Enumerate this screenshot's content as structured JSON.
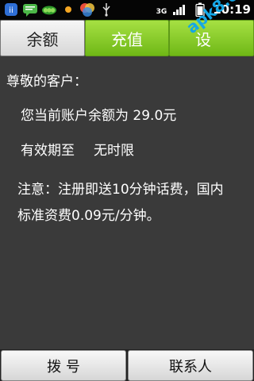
{
  "status_bar": {
    "time": "10:19",
    "network": "3G",
    "icons": [
      "app-icon",
      "message-icon",
      "peas-icon",
      "dot-icon",
      "colorful-icon",
      "usb-icon"
    ]
  },
  "tabs": [
    {
      "label": "余额",
      "active": false
    },
    {
      "label": "充值",
      "active": true
    },
    {
      "label": "设",
      "active": false
    }
  ],
  "watermark": "apk8.com",
  "content": {
    "greeting": "尊敬的客户：",
    "balance_text": "您当前账户余额为 29.0元",
    "validity_label": "有效期至",
    "validity_value": "无时限",
    "notice": "注意：注册即送10分钟话费，国内标准资费0.09元/分钟。"
  },
  "bottom": {
    "dial_label": "拨 号",
    "contacts_label": "联系人"
  },
  "colors": {
    "accent_green": "#7cc41f",
    "content_bg": "#3a3a3a",
    "watermark_blue": "#15a7e6"
  }
}
